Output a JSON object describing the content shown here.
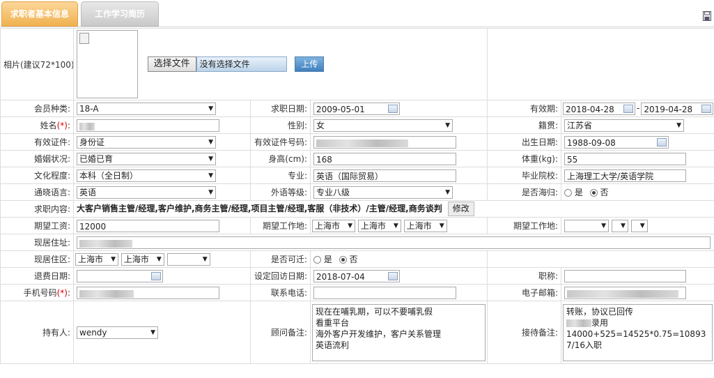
{
  "tabs": [
    {
      "label": "求职者基本信息",
      "active": true
    },
    {
      "label": "工作学习简历",
      "active": false
    }
  ],
  "photo": {
    "label": "相片(建议72*100):",
    "choose_button": "选择文件",
    "no_file_text": "没有选择文件",
    "upload_button": "上传"
  },
  "fields": {
    "member_type": {
      "label": "会员种类:",
      "value": "18-A"
    },
    "job_date": {
      "label": "求职日期:",
      "value": "2009-05-01"
    },
    "valid_period": {
      "label": "有效期:",
      "from": "2018-04-28",
      "sep": "-",
      "to": "2019-04-28"
    },
    "name": {
      "label": "姓名",
      "req": "(*)",
      "colon": ":"
    },
    "gender": {
      "label": "性别:",
      "value": "女"
    },
    "native_place": {
      "label": "籍贯:",
      "value": "江苏省"
    },
    "id_type": {
      "label": "有效证件:",
      "value": "身份证"
    },
    "id_number": {
      "label": "有效证件号码:"
    },
    "birth_date": {
      "label": "出生日期:",
      "value": "1988-09-08"
    },
    "marital": {
      "label": "婚姻状况:",
      "value": "已婚已育"
    },
    "height": {
      "label": "身高(cm):",
      "value": "168"
    },
    "weight": {
      "label": "体重(kg):",
      "value": "55"
    },
    "education": {
      "label": "文化程度:",
      "value": "本科（全日制）"
    },
    "major": {
      "label": "专业:",
      "value": "英语（国际贸易）"
    },
    "school": {
      "label": "毕业院校:",
      "value": "上海理工大学/英语学院"
    },
    "language": {
      "label": "通晓语言:",
      "value": "英语"
    },
    "language_level": {
      "label": "外语等级:",
      "value": "专业八级"
    },
    "returnee": {
      "label": "是否海归:",
      "yes": "是",
      "no": "否",
      "selected": "no"
    },
    "job_content": {
      "label": "求职内容:",
      "value": "大客户销售主管/经理,客户维护,商务主管/经理,项目主管/经理,客服（非技术）/主管/经理,商务谈判",
      "modify_button": "修改"
    },
    "expected_salary": {
      "label": "期望工资:",
      "value": "12000"
    },
    "expected_location": {
      "label": "期望工作地:",
      "values": [
        "上海市",
        "上海市",
        "上海市"
      ]
    },
    "expected_location2": {
      "label": "期望工作地:"
    },
    "address": {
      "label": "现居住址:"
    },
    "district": {
      "label": "现居住区:",
      "values": [
        "上海市",
        "上海市",
        ""
      ]
    },
    "relocate": {
      "label": "是否可迁:",
      "yes": "是",
      "no": "否",
      "selected": "no"
    },
    "refund_date": {
      "label": "退费日期:",
      "value": ""
    },
    "visit_date": {
      "label": "设定回访日期:",
      "value": "2018-07-04"
    },
    "title": {
      "label": "职称:",
      "value": ""
    },
    "mobile": {
      "label": "手机号码",
      "req": "(*)",
      "colon": ":"
    },
    "phone": {
      "label": "联系电话:",
      "value": ""
    },
    "email": {
      "label": "电子邮箱:"
    },
    "owner": {
      "label": "持有人:",
      "value": "wendy"
    },
    "consultant_note": {
      "label": "顾问备注:",
      "value": "现在在哺乳期，可以不要哺乳假\n看重平台\n海外客户开发维护，客户关系管理\n英语流利"
    },
    "reception_note": {
      "label": "接待备注:",
      "line1": "转账，协议已回传",
      "line2": "录用",
      "line3": "14000+525=14525*0.75=10893",
      "line4": "7/16入职"
    }
  }
}
